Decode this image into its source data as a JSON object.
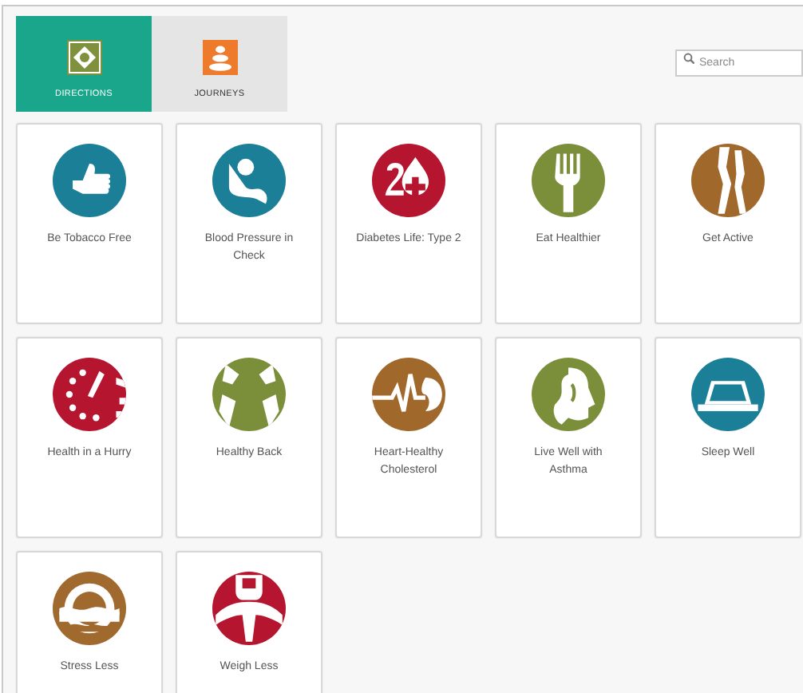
{
  "tabs": [
    {
      "label": "DIRECTIONS",
      "selected": true
    },
    {
      "label": "JOURNEYS",
      "selected": false
    }
  ],
  "search": {
    "placeholder": "Search"
  },
  "items": [
    {
      "label": "Be Tobacco Free",
      "color": "#1b7f98"
    },
    {
      "label": "Blood Pressure in Check",
      "color": "#1b7f98"
    },
    {
      "label": "Diabetes Life: Type 2",
      "color": "#b5152f"
    },
    {
      "label": "Eat Healthier",
      "color": "#7b8f3b"
    },
    {
      "label": "Get Active",
      "color": "#a0682b"
    },
    {
      "label": "Health in a Hurry",
      "color": "#b5152f"
    },
    {
      "label": "Healthy Back",
      "color": "#7b8f3b"
    },
    {
      "label": "Heart-Healthy Cholesterol",
      "color": "#a0682b"
    },
    {
      "label": "Live Well with Asthma",
      "color": "#7b8f3b"
    },
    {
      "label": "Sleep Well",
      "color": "#1b7f98"
    },
    {
      "label": "Stress Less",
      "color": "#a0692e"
    },
    {
      "label": "Weigh Less",
      "color": "#b5152f"
    }
  ]
}
